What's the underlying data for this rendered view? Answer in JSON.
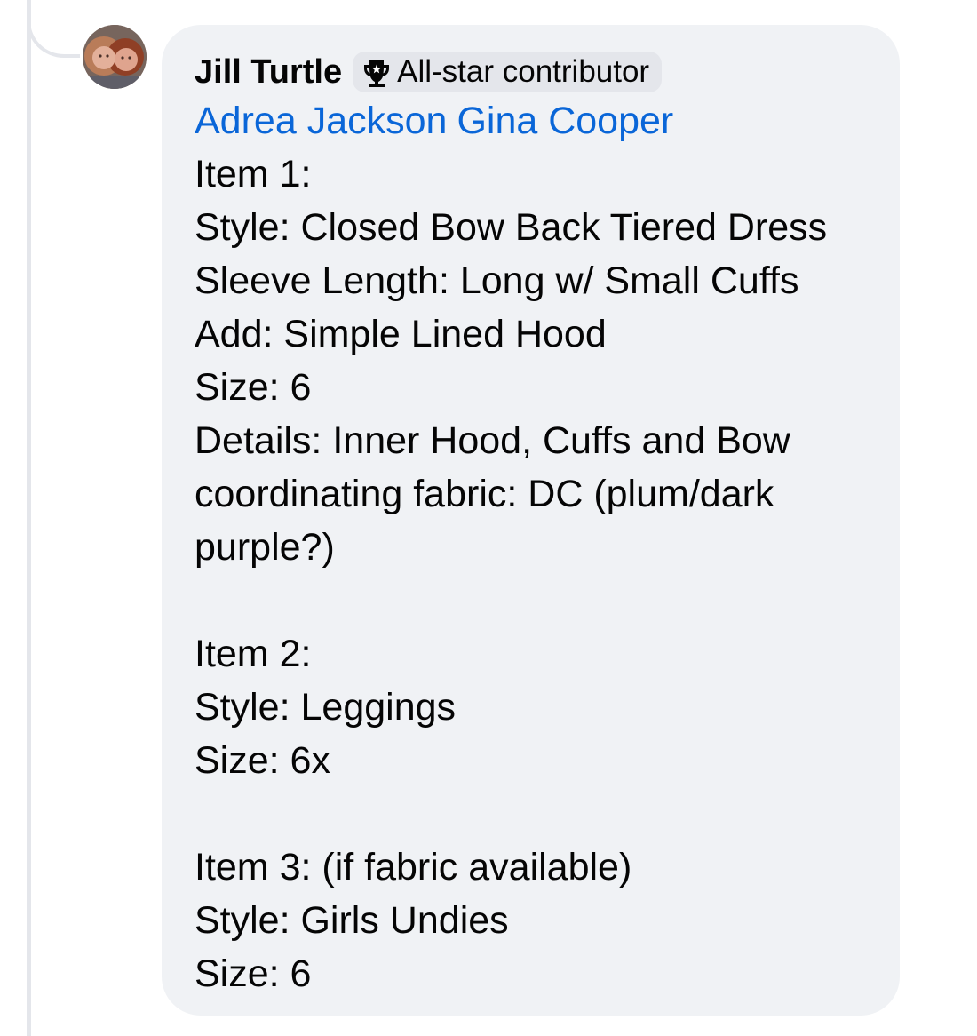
{
  "thread": {
    "avatar_icon": "profile-photo",
    "author_name": "Jill Turtle",
    "badge": {
      "icon": "trophy-icon",
      "label": "All-star contributor"
    },
    "mentions": [
      "Adrea Jackson",
      "Gina Cooper"
    ],
    "lines": [
      "Item 1:",
      "Style: Closed Bow Back Tiered Dress",
      "Sleeve Length: Long w/ Small Cuffs",
      "Add: Simple Lined Hood",
      "Size: 6",
      "Details: Inner Hood, Cuffs and Bow",
      "coordinating fabric: DC (plum/dark",
      "purple?)",
      "",
      "Item 2:",
      "Style: Leggings",
      "Size: 6x",
      "",
      "Item 3: (if fabric available)",
      "Style: Girls Undies",
      "Size: 6"
    ]
  },
  "colors": {
    "bubble_background": "#f0f2f5",
    "badge_background": "#e4e6eb",
    "mention_link": "#0a66d8",
    "text": "#050505",
    "thread_line": "#e4e6eb"
  }
}
